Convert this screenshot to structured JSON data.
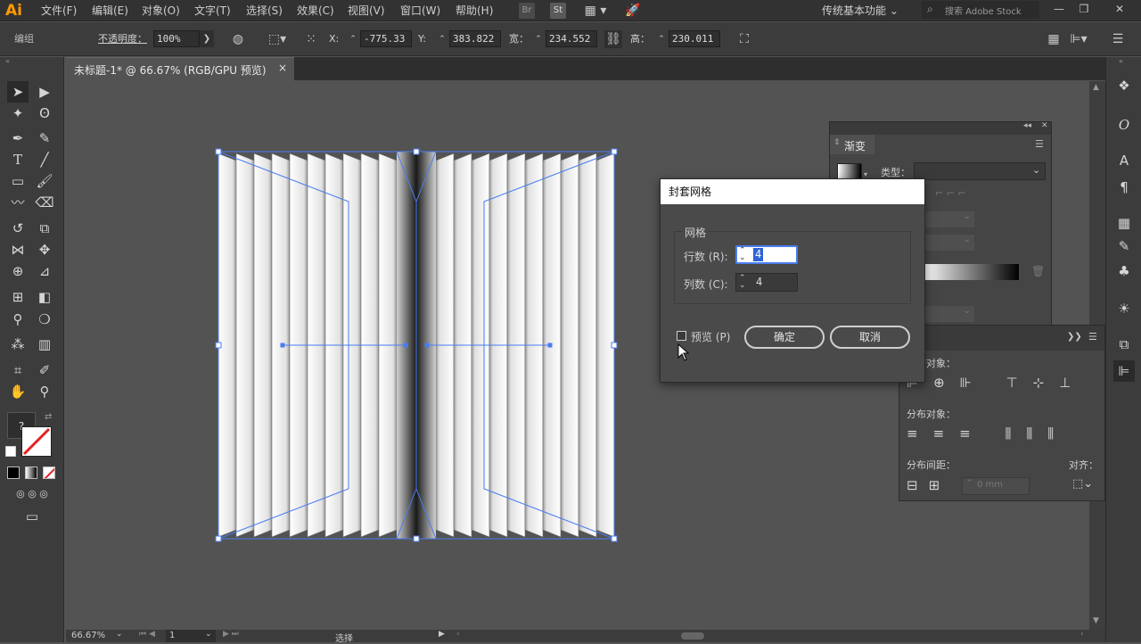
{
  "app": {
    "logo": "Ai"
  },
  "menu": [
    "文件(F)",
    "编辑(E)",
    "对象(O)",
    "文字(T)",
    "选择(S)",
    "效果(C)",
    "视图(V)",
    "窗口(W)",
    "帮助(H)"
  ],
  "menubar_right": {
    "br": "Br",
    "st": "St",
    "workspace": "传统基本功能",
    "search_placeholder": "搜索 Adobe Stock"
  },
  "control_bar": {
    "group_label": "编组",
    "opacity_label": "不透明度：",
    "opacity_value": "100%",
    "x_label": "X:",
    "x_value": "-775.33 n",
    "y_label": "Y:",
    "y_value": "383.822 n",
    "w_label": "宽：",
    "w_value": "234.552 n",
    "h_label": "高：",
    "h_value": "230.011 n"
  },
  "document": {
    "tab_title": "未标题-1* @ 66.67% (RGB/GPU 预览)",
    "close": "×"
  },
  "toolbox": {
    "help": "?"
  },
  "gradient_panel": {
    "title": "渐变",
    "type_label": "类型："
  },
  "align_panel": {
    "align_objects": "对齐对象：",
    "distribute_objects": "分布对象：",
    "distribute_spacing": "分布间距：",
    "align_to": "对齐：",
    "spacing_value": "0 mm"
  },
  "dialog": {
    "title": "封套网格",
    "group": "网格",
    "rows_label": "行数 (R):",
    "rows_value": "4",
    "cols_label": "列数 (C):",
    "cols_value": "4",
    "preview_label": "预览 (P)",
    "ok": "确定",
    "cancel": "取消"
  },
  "status": {
    "zoom": "66.67%",
    "page": "1",
    "tool": "选择"
  },
  "colors": {
    "selection": "#4a7df0",
    "app_bg": "#323232",
    "canvas": "#535353",
    "ai_orange": "#ff9a00"
  }
}
